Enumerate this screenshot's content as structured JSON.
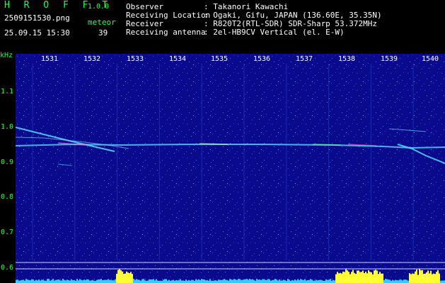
{
  "header": {
    "app_title": "H R O F F T",
    "app_version": "1.0.0",
    "file_name": "2509151530.png",
    "date_time": "25.09.15 15:30",
    "meteor_label": "meteor",
    "meteor_count": "39"
  },
  "info": {
    "rows": [
      {
        "label": "Observer",
        "value": ": Takanori Kawachi"
      },
      {
        "label": "Receiving Location",
        "value": ": Ogaki, Gifu, JAPAN (136.60E, 35.35N)"
      },
      {
        "label": "Receiver",
        "value": ": R820T2(RTL-SDR) SDR-Sharp 53.372MHz"
      },
      {
        "label": "Receiving antenna",
        "value": ": 2el-HB9CV Vertical (el. E-W)"
      }
    ]
  },
  "y_axis": {
    "unit": "kHz",
    "ticks": [
      "1.1",
      "1.0",
      "0.9",
      "0.8",
      "0.7",
      "0.6"
    ]
  },
  "x_axis": {
    "ticks": [
      "1531",
      "1532",
      "1533",
      "1534",
      "1535",
      "1536",
      "1537",
      "1538",
      "1539",
      "1540"
    ]
  },
  "colors": {
    "background": "#0a0a8c",
    "label_green": "#22ff44",
    "trace_cyan": "#55ddff",
    "level_yellow": "#ffff33",
    "level_cyan": "#33ccff"
  }
}
